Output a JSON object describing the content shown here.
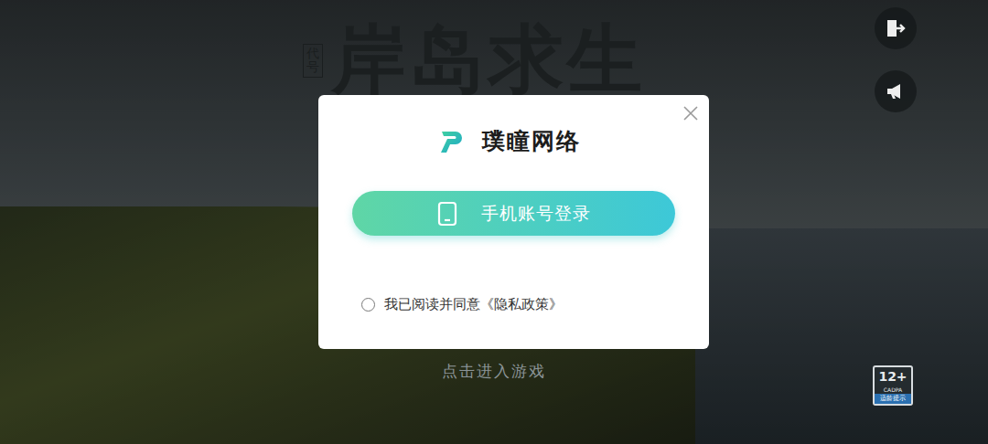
{
  "game_title": {
    "prefix": "代号",
    "name": "岸岛求生"
  },
  "login_dialog": {
    "brand": "璞瞳网络",
    "login_button": "手机账号登录",
    "agreement": {
      "checked": false,
      "text": "我已阅读并同意",
      "link": "《隐私政策》"
    }
  },
  "enter_game": "点击进入游戏",
  "age_badge": {
    "rating": "12+",
    "org": "CADPA",
    "label": "适龄提示"
  }
}
